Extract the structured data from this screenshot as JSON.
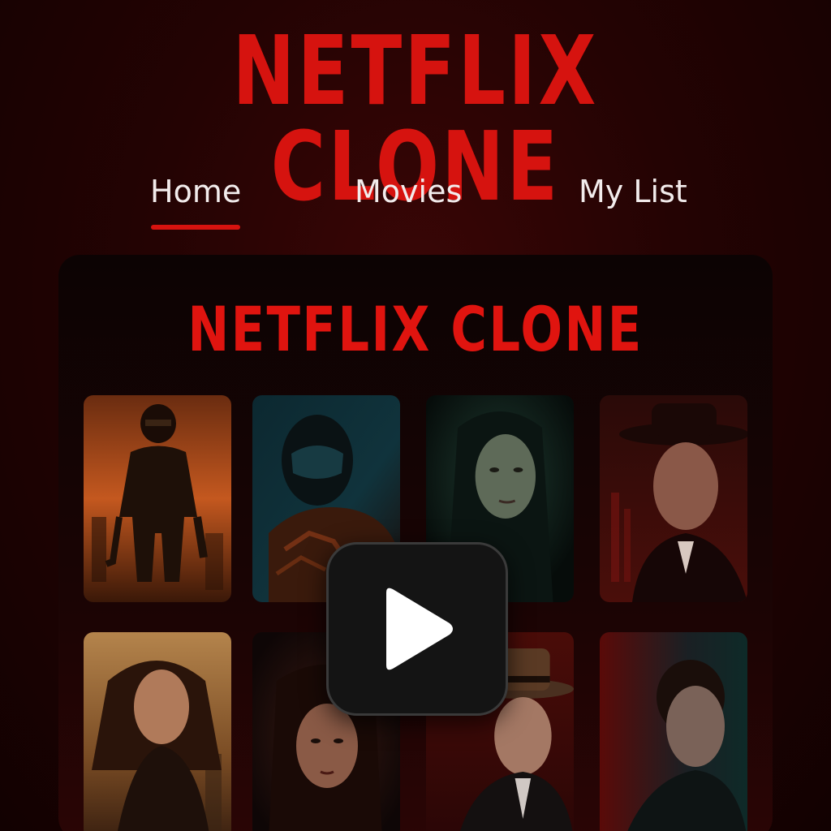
{
  "app": {
    "title": "NETFLIX CLONE"
  },
  "nav": {
    "tabs": [
      {
        "label": "Home",
        "active": true
      },
      {
        "label": "Movies",
        "active": false
      },
      {
        "label": "My List",
        "active": false
      }
    ]
  },
  "panel": {
    "title": "NETFLIX CLONE",
    "play_icon": "play-icon",
    "posters": [
      {
        "name": "poster-armored-soldier",
        "tone": "orange"
      },
      {
        "name": "poster-helmet-warrior",
        "tone": "teal"
      },
      {
        "name": "poster-woman-dark",
        "tone": "green"
      },
      {
        "name": "poster-man-fedora",
        "tone": "red"
      },
      {
        "name": "poster-woman-windswept",
        "tone": "amber"
      },
      {
        "name": "poster-woman-shadow",
        "tone": "crimson"
      },
      {
        "name": "poster-man-hat-suit",
        "tone": "red"
      },
      {
        "name": "poster-man-profile",
        "tone": "teal-red"
      }
    ]
  },
  "colors": {
    "accent": "#d6130f",
    "background": "#240303",
    "panel": "#120303",
    "text": "#f2ecec"
  }
}
